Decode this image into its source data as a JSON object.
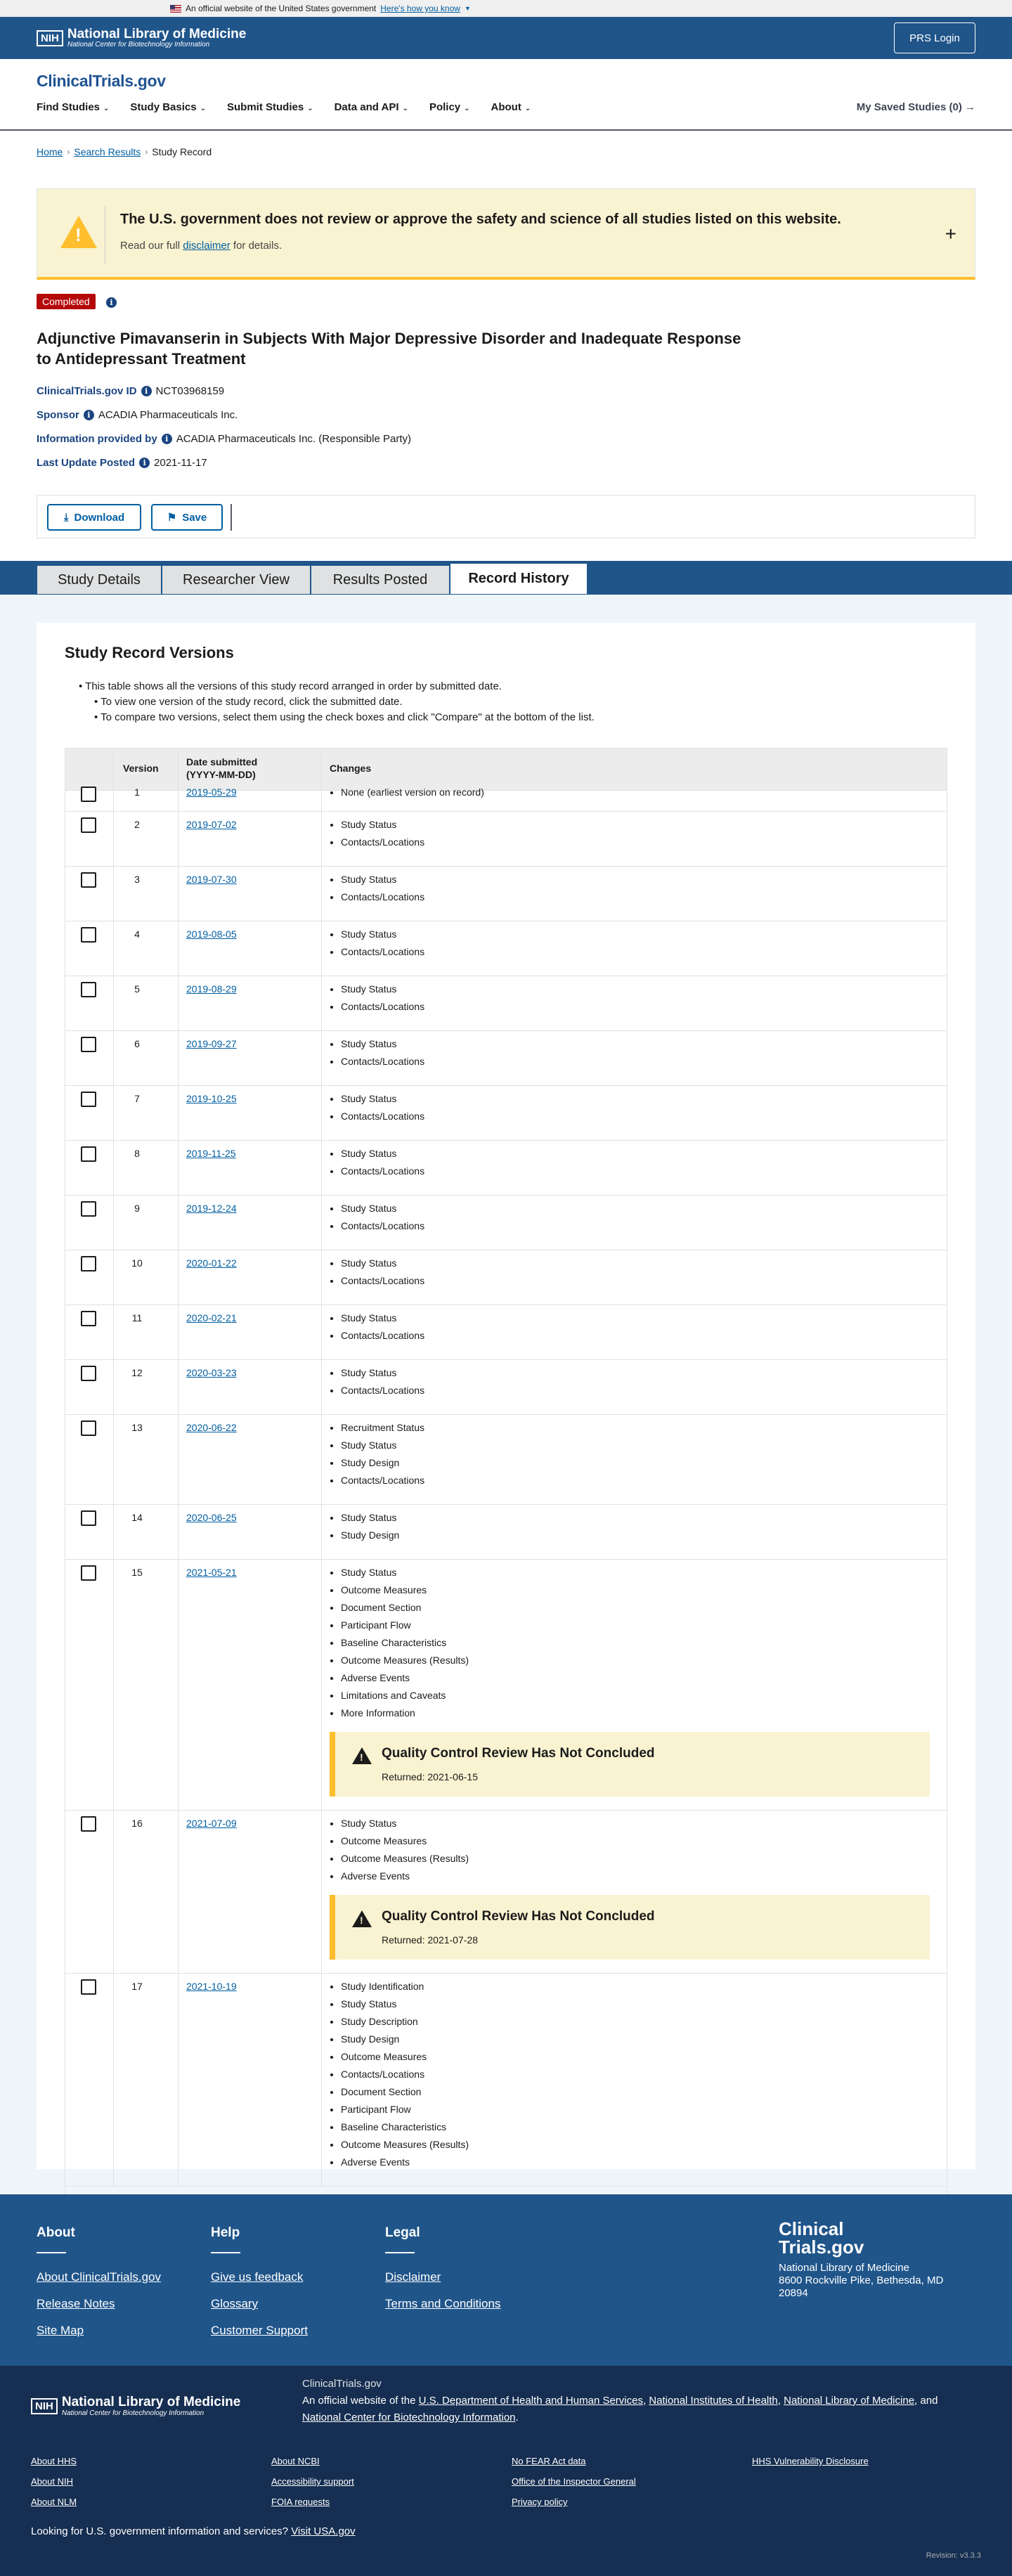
{
  "gov_banner": {
    "text": "An official website of the United States government",
    "link": "Here's how you know"
  },
  "nlm_header": {
    "nih": "NIH",
    "title": "National Library of Medicine",
    "subtitle": "National Center for Biotechnology Information",
    "prs_login": "PRS Login"
  },
  "site": {
    "logo": "ClinicalTrials.gov"
  },
  "nav": {
    "items": [
      "Find Studies",
      "Study Basics",
      "Submit Studies",
      "Data and API",
      "Policy",
      "About"
    ],
    "saved": "My Saved Studies (0)"
  },
  "breadcrumb": {
    "home": "Home",
    "search": "Search Results",
    "current": "Study Record"
  },
  "alert": {
    "title": "The U.S. government does not review or approve the safety and science of all studies listed on this website.",
    "pre": "Read our full",
    "link": "disclaimer",
    "post": "for details.",
    "expand": "+"
  },
  "study": {
    "status": "Completed",
    "title": "Adjunctive Pimavanserin in Subjects With Major Depressive Disorder and Inadequate Response to Antidepressant Treatment",
    "id_label": "ClinicalTrials.gov ID",
    "id": "NCT03968159",
    "sponsor_label": "Sponsor",
    "sponsor": "ACADIA Pharmaceuticals Inc.",
    "info_label": "Information provided by",
    "info": "ACADIA Pharmaceuticals Inc. (Responsible Party)",
    "update_label": "Last Update Posted",
    "update": "2021-11-17"
  },
  "actions": {
    "download": "Download",
    "save": "Save"
  },
  "tabs": [
    "Study Details",
    "Researcher View",
    "Results Posted",
    "Record History"
  ],
  "history": {
    "title": "Study Record Versions",
    "bullet1": "This table shows all the versions of this study record arranged in order by submitted date.",
    "bullet2": "To view one version of the study record, click the submitted date.",
    "bullet3": "To compare two versions, select them using the check boxes and click \"Compare\" at the bottom of the list.",
    "col_version": "Version",
    "col_date": "Date submitted (YYYY-MM-DD)",
    "col_changes": "Changes",
    "rows": [
      {
        "v": "1",
        "date": "2019-05-29",
        "changes": [
          "None (earliest version on record)"
        ]
      },
      {
        "v": "2",
        "date": "2019-07-02",
        "changes": [
          "Study Status",
          "Contacts/Locations"
        ]
      },
      {
        "v": "3",
        "date": "2019-07-30",
        "changes": [
          "Study Status",
          "Contacts/Locations"
        ]
      },
      {
        "v": "4",
        "date": "2019-08-05",
        "changes": [
          "Study Status",
          "Contacts/Locations"
        ]
      },
      {
        "v": "5",
        "date": "2019-08-29",
        "changes": [
          "Study Status",
          "Contacts/Locations"
        ]
      },
      {
        "v": "6",
        "date": "2019-09-27",
        "changes": [
          "Study Status",
          "Contacts/Locations"
        ]
      },
      {
        "v": "7",
        "date": "2019-10-25",
        "changes": [
          "Study Status",
          "Contacts/Locations"
        ]
      },
      {
        "v": "8",
        "date": "2019-11-25",
        "changes": [
          "Study Status",
          "Contacts/Locations"
        ]
      },
      {
        "v": "9",
        "date": "2019-12-24",
        "changes": [
          "Study Status",
          "Contacts/Locations"
        ]
      },
      {
        "v": "10",
        "date": "2020-01-22",
        "changes": [
          "Study Status",
          "Contacts/Locations"
        ]
      },
      {
        "v": "11",
        "date": "2020-02-21",
        "changes": [
          "Study Status",
          "Contacts/Locations"
        ]
      },
      {
        "v": "12",
        "date": "2020-03-23",
        "changes": [
          "Study Status",
          "Contacts/Locations"
        ]
      },
      {
        "v": "13",
        "date": "2020-06-22",
        "changes": [
          "Recruitment Status",
          "Study Status",
          "Study Design",
          "Contacts/Locations"
        ]
      },
      {
        "v": "14",
        "date": "2020-06-25",
        "changes": [
          "Study Status",
          "Study Design"
        ]
      },
      {
        "v": "15",
        "date": "2021-05-21",
        "changes": [
          "Study Status",
          "Outcome Measures",
          "Document Section",
          "Participant Flow",
          "Baseline Characteristics",
          "Outcome Measures (Results)",
          "Adverse Events",
          "Limitations and Caveats",
          "More Information"
        ],
        "qc": {
          "title": "Quality Control Review Has Not Concluded",
          "returned": "Returned: 2021-06-15"
        }
      },
      {
        "v": "16",
        "date": "2021-07-09",
        "changes": [
          "Study Status",
          "Outcome Measures",
          "Outcome Measures (Results)",
          "Adverse Events"
        ],
        "qc": {
          "title": "Quality Control Review Has Not Concluded",
          "returned": "Returned: 2021-07-28"
        }
      },
      {
        "v": "17",
        "date": "2021-10-19",
        "changes": [
          "Study Identification",
          "Study Status",
          "Study Description",
          "Study Design",
          "Outcome Measures",
          "Contacts/Locations",
          "Document Section",
          "Participant Flow",
          "Baseline Characteristics",
          "Outcome Measures (Results)",
          "Adverse Events"
        ]
      }
    ]
  },
  "footer": {
    "about_title": "About",
    "about_links": [
      "About ClinicalTrials.gov",
      "Release Notes",
      "Site Map"
    ],
    "help_title": "Help",
    "help_links": [
      "Give us feedback",
      "Glossary",
      "Customer Support"
    ],
    "legal_title": "Legal",
    "legal_links": [
      "Disclaimer",
      "Terms and Conditions"
    ],
    "logo_line1": "Clinical",
    "logo_line2": "Trials.gov",
    "address1": "National Library of Medicine",
    "address2": "8600 Rockville Pike, Bethesda, MD 20894",
    "nlm_site": "ClinicalTrials.gov",
    "official_pre": "An official website of the",
    "hhs": "U.S. Department of Health and Human Services",
    "nih": "National Institutes of Health",
    "nlm": "National Library of Medicine",
    "and": "and",
    "ncbi": "National Center for Biotechnology Information",
    "col1": [
      "About HHS",
      "About NIH",
      "About NLM"
    ],
    "col2": [
      "About NCBI",
      "Accessibility support",
      "FOIA requests"
    ],
    "col3": [
      "No FEAR Act data",
      "Office of the Inspector General",
      "Privacy policy"
    ],
    "col4": [
      "HHS Vulnerability Disclosure"
    ],
    "usa_pre": "Looking for U.S. government information and services?",
    "usa_link": "Visit USA.gov",
    "revision": "Revision: v3.3.3"
  }
}
